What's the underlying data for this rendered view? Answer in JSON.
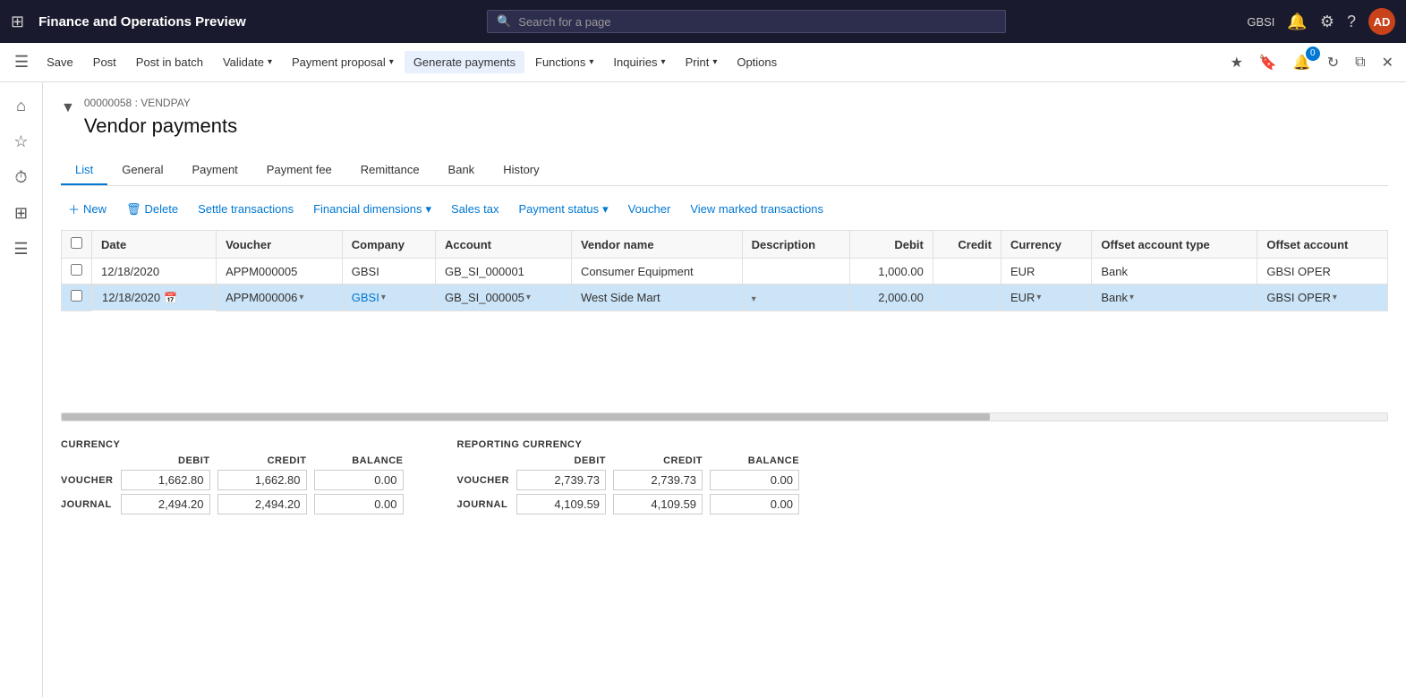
{
  "app": {
    "title": "Finance and Operations Preview",
    "search_placeholder": "Search for a page",
    "user_initials": "AD",
    "company_code": "GBSI"
  },
  "action_bar": {
    "save_label": "Save",
    "post_label": "Post",
    "post_in_batch_label": "Post in batch",
    "validate_label": "Validate",
    "validate_chevron": "▾",
    "payment_proposal_label": "Payment proposal",
    "payment_proposal_chevron": "▾",
    "generate_payments_label": "Generate payments",
    "functions_label": "Functions",
    "functions_chevron": "▾",
    "inquiries_label": "Inquiries",
    "inquiries_chevron": "▾",
    "print_label": "Print",
    "print_chevron": "▾",
    "options_label": "Options"
  },
  "breadcrumb": "00000058 : VENDPAY",
  "page_title": "Vendor payments",
  "tabs": [
    {
      "id": "list",
      "label": "List",
      "active": true
    },
    {
      "id": "general",
      "label": "General"
    },
    {
      "id": "payment",
      "label": "Payment"
    },
    {
      "id": "payment_fee",
      "label": "Payment fee"
    },
    {
      "id": "remittance",
      "label": "Remittance"
    },
    {
      "id": "bank",
      "label": "Bank"
    },
    {
      "id": "history",
      "label": "History"
    }
  ],
  "grid_toolbar": {
    "new_label": "New",
    "delete_label": "Delete",
    "settle_transactions_label": "Settle transactions",
    "financial_dimensions_label": "Financial dimensions",
    "financial_dimensions_chevron": "▾",
    "sales_tax_label": "Sales tax",
    "payment_status_label": "Payment status",
    "payment_status_chevron": "▾",
    "voucher_label": "Voucher",
    "view_marked_transactions_label": "View marked transactions"
  },
  "table": {
    "columns": [
      {
        "id": "check",
        "label": ""
      },
      {
        "id": "date",
        "label": "Date"
      },
      {
        "id": "voucher",
        "label": "Voucher"
      },
      {
        "id": "company",
        "label": "Company"
      },
      {
        "id": "account",
        "label": "Account"
      },
      {
        "id": "vendor_name",
        "label": "Vendor name"
      },
      {
        "id": "description",
        "label": "Description"
      },
      {
        "id": "debit",
        "label": "Debit"
      },
      {
        "id": "credit",
        "label": "Credit"
      },
      {
        "id": "currency",
        "label": "Currency"
      },
      {
        "id": "offset_account_type",
        "label": "Offset account type"
      },
      {
        "id": "offset_account",
        "label": "Offset account"
      }
    ],
    "rows": [
      {
        "selected": false,
        "date": "12/18/2020",
        "voucher": "APPM000005",
        "company": "GBSI",
        "account": "GB_SI_000001",
        "vendor_name": "Consumer Equipment",
        "description": "",
        "debit": "1,000.00",
        "credit": "",
        "currency": "EUR",
        "offset_account_type": "Bank",
        "offset_account": "GBSI OPER"
      },
      {
        "selected": true,
        "date": "12/18/2020",
        "voucher": "APPM000006",
        "company": "GBSI",
        "account": "GB_SI_000005",
        "vendor_name": "West Side Mart",
        "description": "",
        "debit": "2,000.00",
        "credit": "",
        "currency": "EUR",
        "offset_account_type": "Bank",
        "offset_account": "GBSI OPER"
      }
    ]
  },
  "footer": {
    "currency_section_label": "CURRENCY",
    "reporting_currency_section_label": "REPORTING CURRENCY",
    "col_debit": "DEBIT",
    "col_credit": "CREDIT",
    "col_balance": "BALANCE",
    "row_voucher": "VOUCHER",
    "row_journal": "JOURNAL",
    "currency": {
      "voucher_debit": "1,662.80",
      "voucher_credit": "1,662.80",
      "voucher_balance": "0.00",
      "journal_debit": "2,494.20",
      "journal_credit": "2,494.20",
      "journal_balance": "0.00"
    },
    "reporting_currency": {
      "voucher_debit": "2,739.73",
      "voucher_credit": "2,739.73",
      "voucher_balance": "0.00",
      "journal_debit": "4,109.59",
      "journal_credit": "4,109.59",
      "journal_balance": "0.00"
    }
  }
}
